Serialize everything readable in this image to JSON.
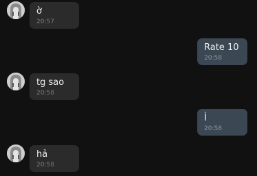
{
  "colors": {
    "background": "#111111",
    "incoming_bubble": "#2b2b2b",
    "outgoing_bubble": "#3c4754",
    "text": "#f0f0f0",
    "timestamp": "#7a7a7a"
  },
  "messages": [
    {
      "direction": "incoming",
      "text": "ờ",
      "time": "20:57",
      "avatar_icon": "user-avatar-icon"
    },
    {
      "direction": "outgoing",
      "text": "Rate 10",
      "time": "20:58"
    },
    {
      "direction": "incoming",
      "text": "tg sao",
      "time": "20:58",
      "avatar_icon": "user-avatar-icon"
    },
    {
      "direction": "outgoing",
      "text": "Ì",
      "time": "20:58"
    },
    {
      "direction": "incoming",
      "text": "hả",
      "time": "20:58",
      "avatar_icon": "user-avatar-icon"
    }
  ]
}
